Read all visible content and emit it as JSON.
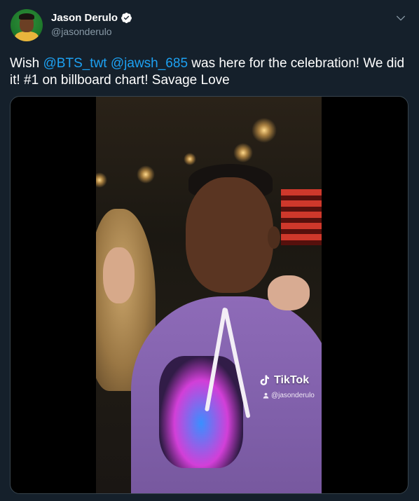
{
  "author": {
    "display_name": "Jason Derulo",
    "handle": "@jasonderulo",
    "verified": true,
    "avatar_icon": "profile-avatar",
    "verified_icon": "verified-badge-icon"
  },
  "tweet": {
    "prefix": "Wish ",
    "mention_1": "@BTS_twt",
    "space": " ",
    "mention_2": "@jawsh_685",
    "suffix": " was here for the celebration! We did it! #1 on billboard chart! Savage Love"
  },
  "media": {
    "watermark_brand": "TikTok",
    "watermark_user": "@jasonderulo",
    "brand_icon": "tiktok-logo-icon",
    "user_icon": "person-icon"
  },
  "colors": {
    "background": "#15202b",
    "link": "#1da1f2",
    "secondary_text": "#8899a6",
    "verified": "#ffffff"
  }
}
